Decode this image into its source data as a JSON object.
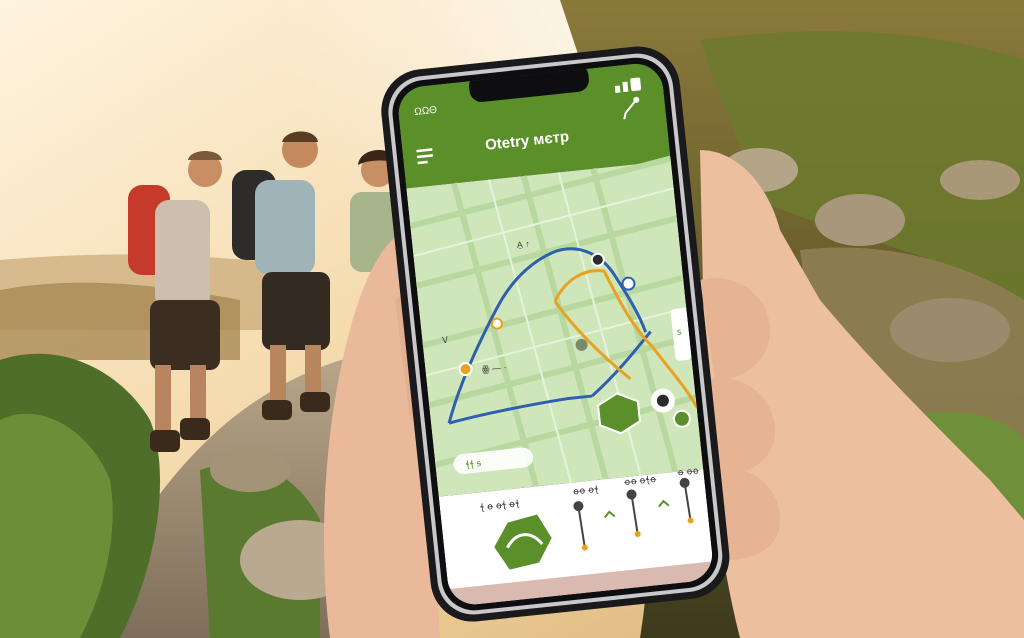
{
  "status_bar": {
    "left": "ΩΩΘ"
  },
  "app": {
    "title": "Otetry мєтр"
  },
  "map_labels": {
    "label_a": "A̱ ↑",
    "label_b": "Ꮩ",
    "label_c": "ꙮ — ·",
    "side_tag": "ꜱ",
    "map_chip": "ꞎꞎ ꟊ"
  },
  "bottom_panel": {
    "col1": "ꞎ ꝋ ꝋꞎ ꝋꞎ",
    "col2": "ꝋꝋ ꝋꞎ",
    "col3": "ꝋꝋ ꝋꞎꝋ",
    "col4": "ꝋ ꝋꝋ"
  },
  "colors": {
    "app_green": "#5b8f2a",
    "map_bg": "#cfe6bb",
    "route_blue": "#2f5fb0",
    "route_orange": "#e9a21f"
  }
}
